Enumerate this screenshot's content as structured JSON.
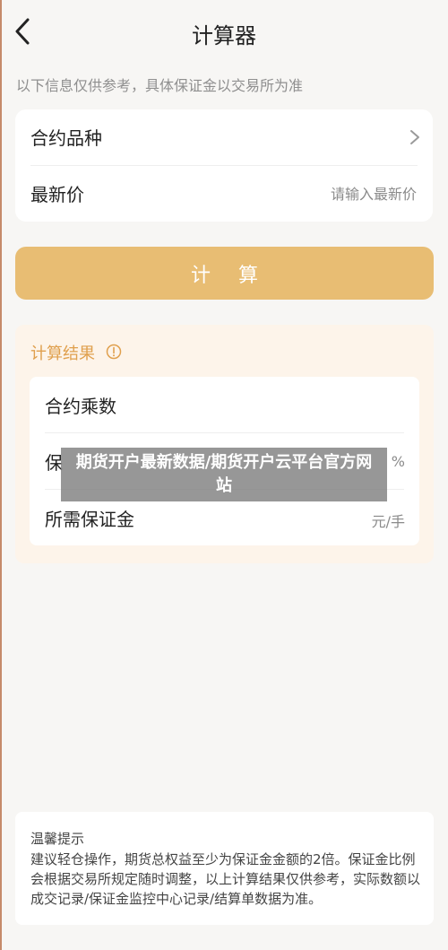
{
  "header": {
    "title": "计算器"
  },
  "notice": "以下信息仅供参考，具体保证金以交易所为准",
  "form": {
    "contract_type_label": "合约品种",
    "latest_price_label": "最新价",
    "latest_price_placeholder": "请输入最新价",
    "latest_price_value": ""
  },
  "actions": {
    "calculate_label": "计 算"
  },
  "result": {
    "title": "计算结果",
    "rows": [
      {
        "label": "合约乘数",
        "unit": ""
      },
      {
        "label": "保",
        "unit": "%"
      },
      {
        "label": "所需保证金",
        "unit": "元/手"
      }
    ]
  },
  "overlay": {
    "text": "期货开户最新数据/期货开户云平台官方网站"
  },
  "tips": {
    "title": "温馨提示",
    "body": "建议轻仓操作，期货总权益至少为保证金金额的2倍。保证金比例会根据交易所规定随时调整，以上计算结果仅供参考，实际数额以成交记录/保证金监控中心记录/结算单数据为准。"
  },
  "colors": {
    "accent": "#e8bd73",
    "accent_text": "#e0a04e",
    "page_bg": "#f7f6f4",
    "result_bg": "#fdf4ea"
  },
  "icons": {
    "back": "chevron-left-icon",
    "row_arrow": "chevron-right-icon",
    "info": "info-circle-icon"
  }
}
